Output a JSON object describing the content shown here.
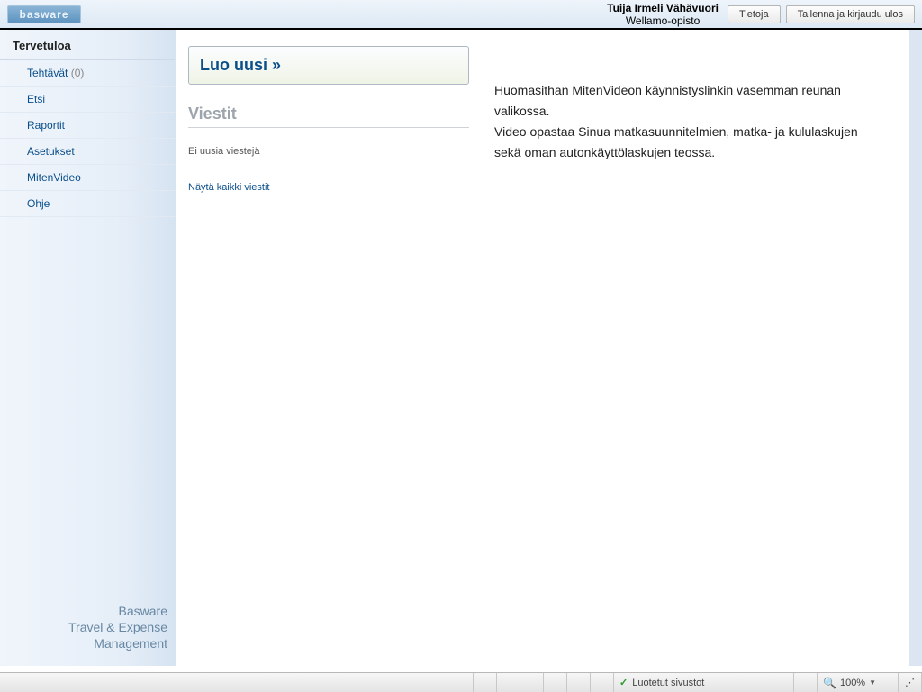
{
  "topbar": {
    "logo_text": "basware",
    "user_name": "Tuija Irmeli Vähävuori",
    "organization": "Wellamo-opisto",
    "btn_info": "Tietoja",
    "btn_logout": "Tallenna ja kirjaudu ulos"
  },
  "sidebar": {
    "heading": "Tervetuloa",
    "items": [
      {
        "label": "Tehtävät",
        "count": "(0)"
      },
      {
        "label": "Etsi"
      },
      {
        "label": "Raportit"
      },
      {
        "label": "Asetukset"
      },
      {
        "label": "MitenVideo"
      },
      {
        "label": "Ohje"
      }
    ],
    "footer_line1": "Basware",
    "footer_line2": "Travel & Expense Management"
  },
  "main": {
    "create_label": "Luo uusi »",
    "messages_heading": "Viestit",
    "no_messages": "Ei uusia viestejä",
    "show_all": "Näytä kaikki viestit",
    "notice_line1": "Huomasithan MitenVideon käynnistyslinkin vasemman reunan valikossa.",
    "notice_line2": "Video opastaa Sinua matkasuunnitelmien, matka- ja kululaskujen",
    "notice_line3": "sekä oman autonkäyttölaskujen teossa."
  },
  "statusbar": {
    "trusted": "Luotetut sivustot",
    "zoom": "100%"
  }
}
